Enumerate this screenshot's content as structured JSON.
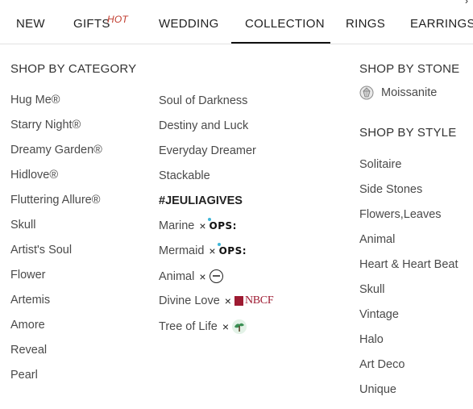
{
  "nav": {
    "items": [
      {
        "label": "NEW"
      },
      {
        "label": "GIFTS",
        "badge": "HOT"
      },
      {
        "label": "WEDDING"
      },
      {
        "label": "COLLECTION",
        "active": true
      },
      {
        "label": "RINGS"
      },
      {
        "label": "EARRINGS"
      }
    ]
  },
  "category": {
    "heading": "SHOP BY CATEGORY",
    "col1": [
      "Hug Me®",
      "Starry Night®",
      "Dreamy Garden®",
      "Hidlove®",
      "Fluttering Allure®",
      "Skull",
      "Artist's Soul",
      "Flower",
      "Artemis",
      "Amore",
      "Reveal",
      "Pearl"
    ],
    "col2": [
      {
        "label": "Soul of Darkness"
      },
      {
        "label": "Destiny and Luck"
      },
      {
        "label": "Everyday Dreamer"
      },
      {
        "label": "Stackable"
      },
      {
        "label": "#JEULIAGIVES",
        "bold": true
      },
      {
        "label": "Marine",
        "collab": "×",
        "logo": "OPS:"
      },
      {
        "label": "Mermaid",
        "collab": "×",
        "logo": "OPS:"
      },
      {
        "label": "Animal",
        "collab": "×",
        "logo": "circle-seal-icon"
      },
      {
        "label": "Divine Love",
        "collab": "×",
        "logo": "NBCF"
      },
      {
        "label": "Tree of Life",
        "collab": "×",
        "logo": "tree-logo-icon"
      }
    ]
  },
  "stone": {
    "heading": "SHOP BY STONE",
    "items": [
      {
        "label": "Moissanite",
        "icon": "diamond-icon"
      }
    ]
  },
  "style": {
    "heading": "SHOP BY STYLE",
    "items": [
      "Solitaire",
      "Side Stones",
      "Flowers,Leaves",
      "Animal",
      "Heart & Heart Beat",
      "Skull",
      "Vintage",
      "Halo",
      "Art Deco",
      "Unique"
    ]
  },
  "colors": {
    "hot": "#c0392b",
    "active_underline": "#111111",
    "ops_dot": "#3fb6d8",
    "nbcf": "#9e1b32"
  }
}
